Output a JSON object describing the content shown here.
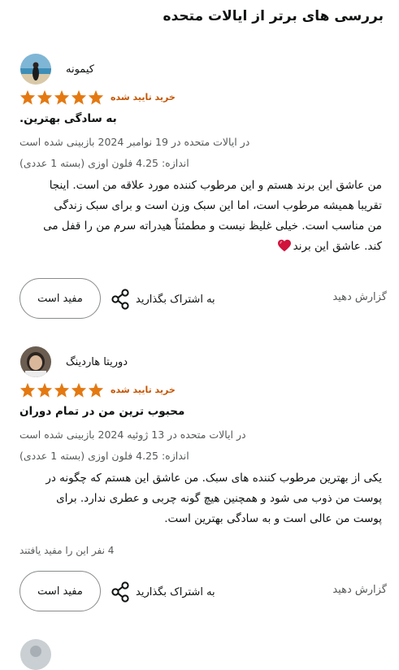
{
  "page": {
    "title": "بررسی های برتر از ایالات متحده"
  },
  "colors": {
    "star": "#e47911",
    "verified": "#c45500",
    "heart": "#d0143c",
    "muted": "#565959"
  },
  "reviews": [
    {
      "reviewer": "کیمونه",
      "avatar_icon": "beach-photo-avatar",
      "rating": 5,
      "verified": "خرید تایید شده",
      "title": "به سادگی بهترین.",
      "date": "در ایالات متحده در 19 نوامبر 2024 بازبینی شده است",
      "size": "اندازه: 4.25 فلون اوزی (بسته 1 عددی)",
      "body_lines": [
        "من عاشق این برند هستم و این مرطوب کننده مورد علاقه من است. اینجا",
        "تقریبا همیشه مرطوب است، اما این سبک وزن است و برای سبک زندگی",
        "من مناسب است. خیلی غلیظ نیست و مطمئناً هیدراته سرم من را قفل می",
        "کند. عاشق این برند"
      ],
      "helpful_count": "",
      "helpful_label": "مفید است",
      "share_label": "به اشتراک بگذارید",
      "report_label": "گزارش دهید"
    },
    {
      "reviewer": "دوریتا هاردینگ",
      "avatar_icon": "person-photo-avatar",
      "rating": 5,
      "verified": "خرید تایید شده",
      "title": "محبوب ترین من در تمام دوران",
      "date": "در ایالات متحده در 13 ژوئیه 2024 بازبینی شده است",
      "size": "اندازه: 4.25 فلون اوزی (بسته 1 عددی)",
      "body_lines": [
        "یکی از بهترین مرطوب کننده های سبک. من عاشق این هستم که چگونه در",
        "پوست من ذوب می شود و همچنین هیچ گونه چربی و عطری ندارد. برای",
        "پوست من عالی است و به سادگی بهترین است."
      ],
      "helpful_count": "4 نفر این را مفید یافتند",
      "helpful_label": "مفید است",
      "share_label": "به اشتراک بگذارید",
      "report_label": "گزارش دهید"
    }
  ]
}
